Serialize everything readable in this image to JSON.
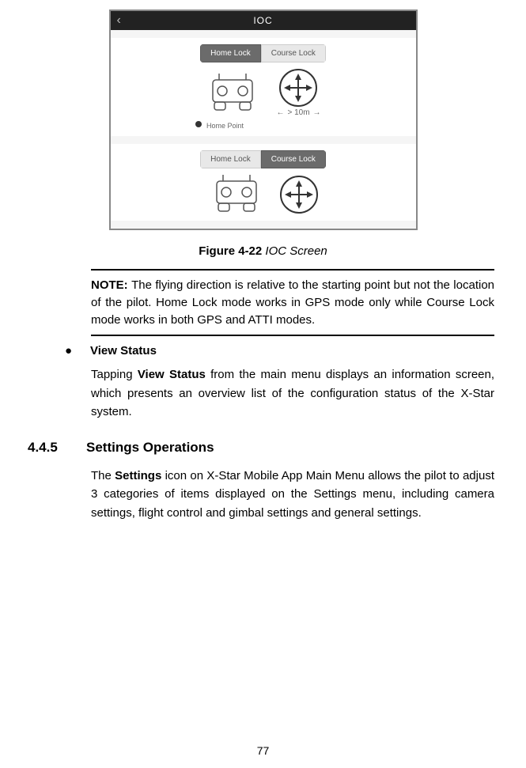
{
  "screenshot": {
    "topbar": {
      "title": "IOC"
    },
    "section1": {
      "seg_active": "Home Lock",
      "seg_inactive": "Course Lock",
      "distance": "> 10m",
      "home_point": "Home Point"
    },
    "section2": {
      "seg_inactive": "Home Lock",
      "seg_active": "Course Lock"
    }
  },
  "figure": {
    "label": "Figure 4-22",
    "title": " IOC Screen"
  },
  "note": {
    "label": "NOTE: ",
    "text": "The flying direction is relative to the starting point but not the location of the pilot. Home Lock mode works in GPS mode only while Course Lock mode works in both GPS and ATTI modes."
  },
  "view_status": {
    "title": "View Status",
    "body_pre": "Tapping ",
    "body_bold": "View Status",
    "body_post": " from the main menu displays an information screen, which presents an overview list of the configuration status of the X-Star system."
  },
  "section_heading": {
    "num": "4.4.5",
    "title": "Settings Operations"
  },
  "settings_body": {
    "pre": "The ",
    "bold": "Settings",
    "post": " icon on X-Star Mobile App Main Menu allows the pilot to adjust 3 categories of items displayed on the Settings menu, including camera settings, flight control and gimbal settings and general settings."
  },
  "page_number": "77"
}
